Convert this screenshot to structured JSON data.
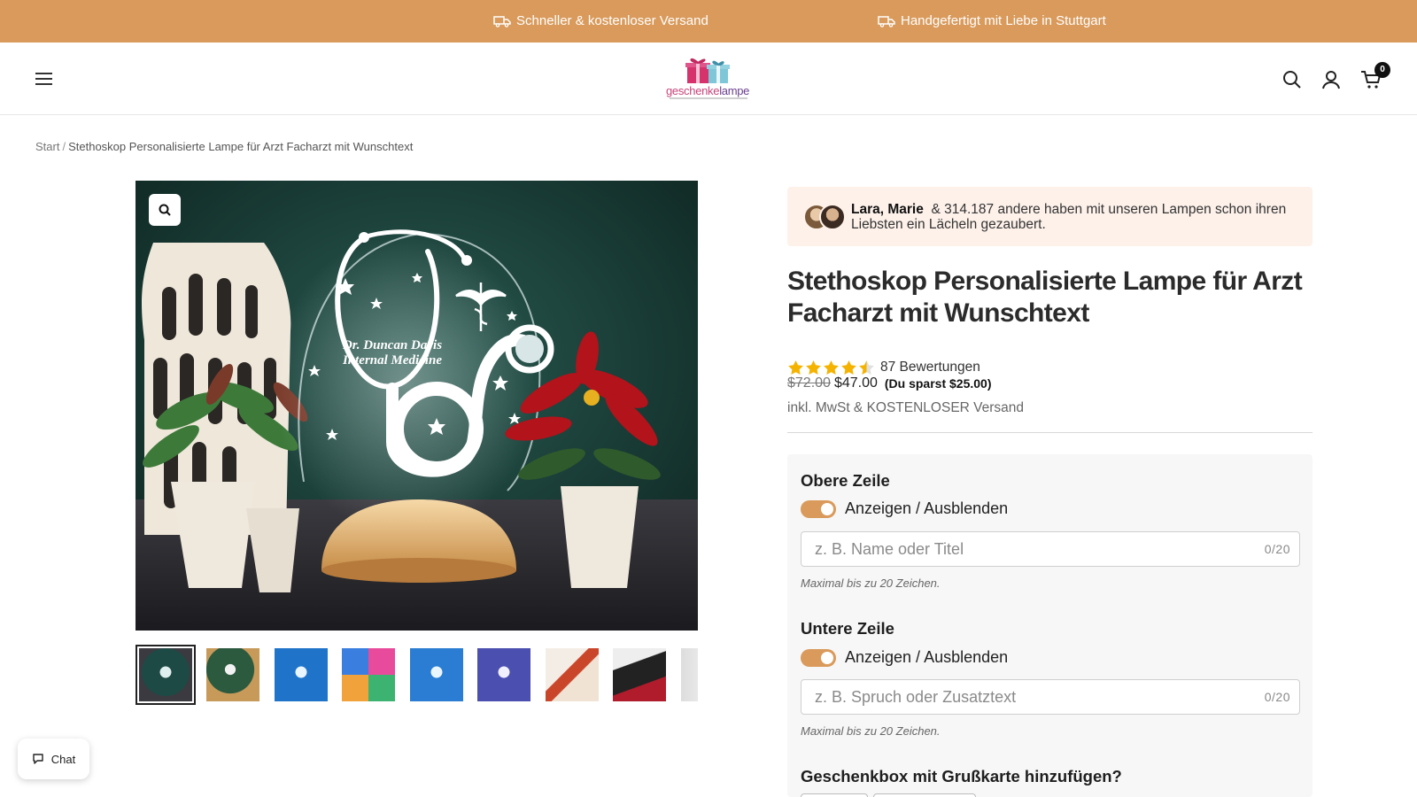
{
  "announcement": {
    "items": [
      {
        "icon": "truck-icon",
        "text": "Schneller & kostenloser Versand"
      },
      {
        "icon": "truck-icon",
        "text": "Handgefertigt mit Liebe in Stuttgart"
      }
    ],
    "bg_color": "#d99a5b"
  },
  "header": {
    "logo": {
      "part1": "geschenke",
      "part2": "lampe"
    },
    "icons": [
      "menu-icon",
      "search-icon",
      "account-icon",
      "cart-icon"
    ],
    "cart_count": "0"
  },
  "breadcrumb": {
    "home": "Start",
    "separator": "/",
    "current": "Stethoskop Personalisierte Lampe für Arzt Facharzt mit Wunschtext"
  },
  "gallery": {
    "image_text": {
      "line1": "Dr. Duncan Davis",
      "line2": "Internal Medicine"
    },
    "zoom_icon": "zoom-icon",
    "thumbnail_count": 9,
    "active_thumbnail": 1
  },
  "social_proof": {
    "names": "Lara, Marie",
    "text": "& 314.187 andere haben mit unseren Lampen schon ihren Liebsten ein Lächeln gezaubert."
  },
  "product": {
    "title": "Stethoskop Personalisierte Lampe für Arzt Facharzt mit Wunschtext",
    "rating": {
      "stars": 4.5,
      "count_text": "87 Bewertungen"
    },
    "price_old": "$72.00",
    "price_new": "$47.00",
    "savings": "(Du sparst $25.00)",
    "tax_note": "inkl. MwSt & KOSTENLOSER Versand"
  },
  "options": {
    "top_line": {
      "label": "Obere Zeile",
      "toggle_label": "Anzeigen / Ausblenden",
      "toggle_on": true,
      "placeholder": "z. B. Name oder Titel",
      "counter": "0/20",
      "hint": "Maximal bis zu 20 Zeichen."
    },
    "bottom_line": {
      "label": "Untere Zeile",
      "toggle_label": "Anzeigen / Ausblenden",
      "toggle_on": true,
      "placeholder": "z. B. Spruch oder Zusatztext",
      "counter": "0/20",
      "hint": "Maximal bis zu 20 Zeichen."
    },
    "giftbox": {
      "label": "Geschenkbox mit Grußkarte hinzufügen?"
    }
  },
  "chat": {
    "label": "Chat",
    "icon": "chat-bubble-icon"
  },
  "colors": {
    "accent": "#d99a5b",
    "social_bg": "#fdf1ea",
    "star": "#f5b301"
  }
}
